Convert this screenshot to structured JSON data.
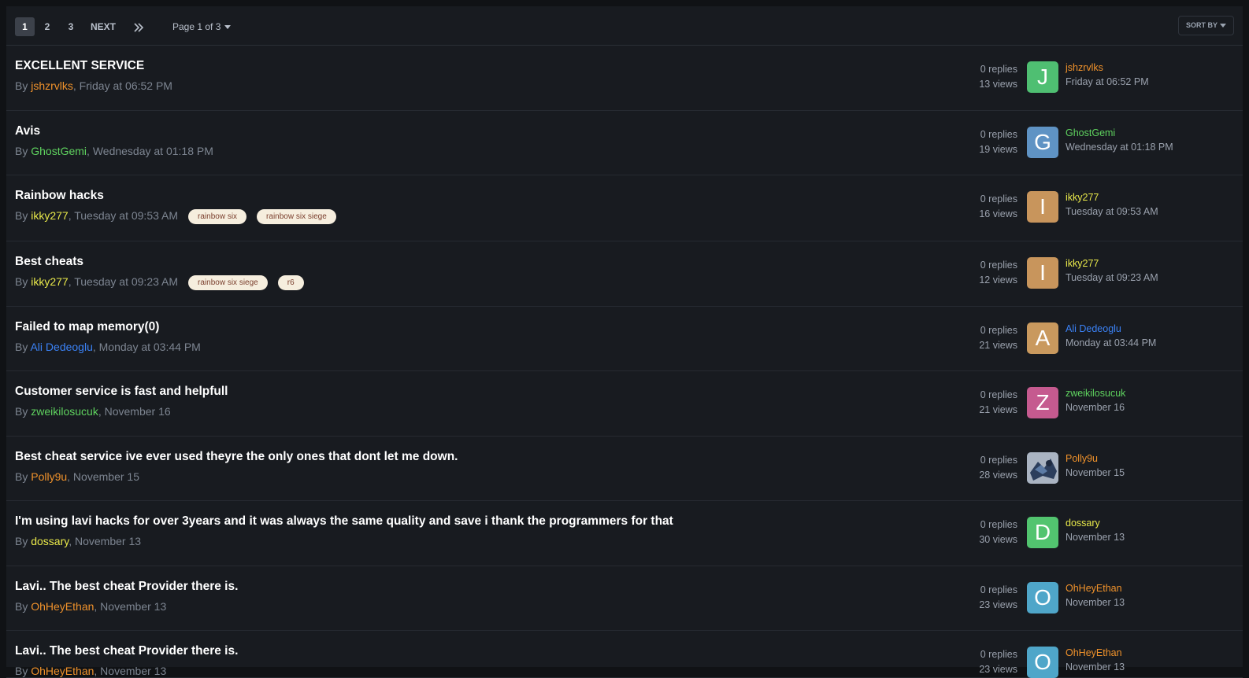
{
  "pagination": {
    "pages": [
      "1",
      "2",
      "3"
    ],
    "next_label": "NEXT",
    "last_icon": "double-chevron-right-icon",
    "page_info": "Page 1 of 3",
    "sort_label": "SORT BY"
  },
  "colors": {
    "orange": "#f0922b",
    "green": "#5fd35f",
    "yellow": "#e9e94a",
    "blue": "#3b82f6"
  },
  "topics": [
    {
      "title": "EXCELLENT SERVICE",
      "by": "By ",
      "author": "jshzrvlks",
      "date": ", Friday at 06:52 PM",
      "tags": [],
      "replies": "0 replies",
      "views": "13 views",
      "avatar_letter": "J",
      "avatar_color": "#4fbf72",
      "last_user": "jshzrvlks",
      "last_date": "Friday at 06:52 PM",
      "user_color": "#f0922b"
    },
    {
      "title": "Avis",
      "by": "By ",
      "author": "GhostGemi",
      "date": ", Wednesday at 01:18 PM",
      "tags": [],
      "replies": "0 replies",
      "views": "19 views",
      "avatar_letter": "G",
      "avatar_color": "#5f93c4",
      "last_user": "GhostGemi",
      "last_date": "Wednesday at 01:18 PM",
      "user_color": "#5fd35f"
    },
    {
      "title": "Rainbow hacks",
      "by": "By ",
      "author": "ikky277",
      "date": ", Tuesday at 09:53 AM",
      "tags": [
        "rainbow six",
        "rainbow six siege"
      ],
      "replies": "0 replies",
      "views": "16 views",
      "avatar_letter": "I",
      "avatar_color": "#c8955c",
      "last_user": "ikky277",
      "last_date": "Tuesday at 09:53 AM",
      "user_color": "#e9e94a"
    },
    {
      "title": "Best cheats",
      "by": "By ",
      "author": "ikky277",
      "date": ", Tuesday at 09:23 AM",
      "tags": [
        "rainbow six siege",
        "r6"
      ],
      "replies": "0 replies",
      "views": "12 views",
      "avatar_letter": "I",
      "avatar_color": "#c8955c",
      "last_user": "ikky277",
      "last_date": "Tuesday at 09:23 AM",
      "user_color": "#e9e94a"
    },
    {
      "title": "Failed to map memory(0)",
      "by": "By ",
      "author": "Ali Dedeoglu",
      "date": ", Monday at 03:44 PM",
      "tags": [],
      "replies": "0 replies",
      "views": "21 views",
      "avatar_letter": "A",
      "avatar_color": "#c9995e",
      "last_user": "Ali Dedeoglu",
      "last_date": "Monday at 03:44 PM",
      "user_color": "#3b82f6"
    },
    {
      "title": "Customer service is fast and helpfull",
      "by": "By ",
      "author": "zweikilosucuk",
      "date": ", November 16",
      "tags": [],
      "replies": "0 replies",
      "views": "21 views",
      "avatar_letter": "Z",
      "avatar_color": "#c55a8f",
      "last_user": "zweikilosucuk",
      "last_date": "November 16",
      "user_color": "#5fd35f"
    },
    {
      "title": "Best cheat service ive ever used theyre the only ones that dont let me down.",
      "by": "By ",
      "author": "Polly9u",
      "date": ", November 15",
      "tags": [],
      "replies": "0 replies",
      "views": "28 views",
      "avatar_letter": "",
      "avatar_color": "#5c6f86",
      "last_user": "Polly9u",
      "last_date": "November 15",
      "user_color": "#f0922b"
    },
    {
      "title": "I'm using lavi hacks for over 3years and it was always the same quality and save i thank the programmers for that",
      "by": "By ",
      "author": "dossary",
      "date": ", November 13",
      "tags": [],
      "replies": "0 replies",
      "views": "30 views",
      "avatar_letter": "D",
      "avatar_color": "#52c46f",
      "last_user": "dossary",
      "last_date": "November 13",
      "user_color": "#e9e94a"
    },
    {
      "title": "Lavi.. The best cheat Provider there is.",
      "by": "By ",
      "author": "OhHeyEthan",
      "date": ", November 13",
      "tags": [],
      "replies": "0 replies",
      "views": "23 views",
      "avatar_letter": "O",
      "avatar_color": "#4fa6c9",
      "last_user": "OhHeyEthan",
      "last_date": "November 13",
      "user_color": "#f0922b"
    },
    {
      "title": "Lavi.. The best cheat Provider there is.",
      "by": "By ",
      "author": "OhHeyEthan",
      "date": ", November 13",
      "tags": [],
      "replies": "0 replies",
      "views": "23 views",
      "avatar_letter": "O",
      "avatar_color": "#4fa6c9",
      "last_user": "OhHeyEthan",
      "last_date": "November 13",
      "user_color": "#f0922b"
    }
  ]
}
